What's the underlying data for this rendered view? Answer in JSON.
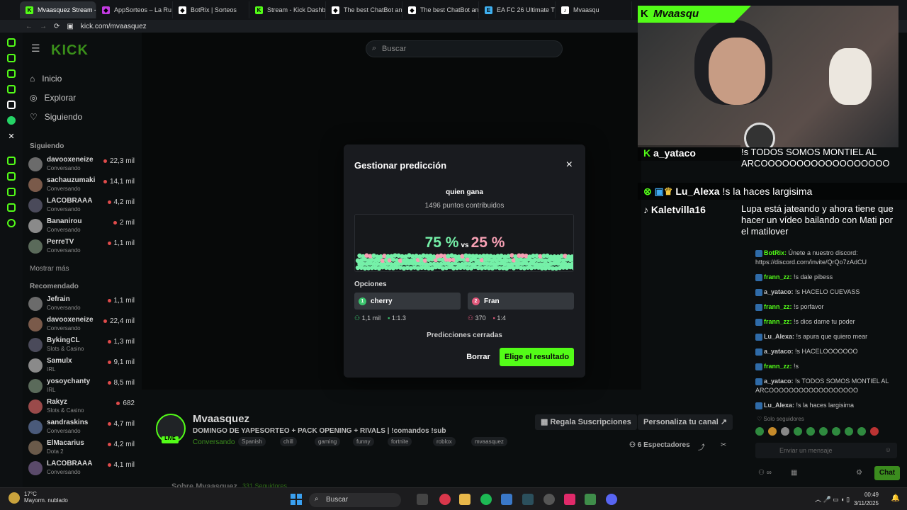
{
  "browser": {
    "tabs": [
      {
        "label": "Mvaasquez Stream - Wat",
        "color": "#53fc18",
        "glyph": "K",
        "active": true
      },
      {
        "label": "AppSorteos – La Ru",
        "color": "#c23ae0",
        "glyph": "◆",
        "active": false
      },
      {
        "label": "BotRix | Sorteos",
        "color": "#ffffff",
        "glyph": "◆",
        "active": false
      },
      {
        "label": "Stream - Kick Dashb",
        "color": "#53fc18",
        "glyph": "K",
        "active": false
      },
      {
        "label": "The best ChatBot an",
        "color": "#ffffff",
        "glyph": "◆",
        "active": false
      },
      {
        "label": "The best ChatBot an",
        "color": "#ffffff",
        "glyph": "◆",
        "active": false
      },
      {
        "label": "EA FC 26 Ultimate T",
        "color": "#3fb0f0",
        "glyph": "E",
        "active": false
      },
      {
        "label": "Mvaasqu",
        "color": "#ffffff",
        "glyph": "♪",
        "active": false
      }
    ],
    "url": "kick.com/mvaasquez"
  },
  "sidebar": {
    "nav": [
      {
        "label": "Inicio",
        "icon": "home-icon"
      },
      {
        "label": "Explorar",
        "icon": "compass-icon"
      },
      {
        "label": "Siguiendo",
        "icon": "heart-icon"
      }
    ],
    "following_title": "Siguiendo",
    "following": [
      {
        "name": "davooxeneize",
        "cat": "Conversando",
        "viewers": "22,3 mil"
      },
      {
        "name": "sachauzumaki",
        "cat": "Conversando",
        "viewers": "14,1 mil"
      },
      {
        "name": "LACOBRAAA",
        "cat": "Conversando",
        "viewers": "4,2 mil"
      },
      {
        "name": "Bananirou",
        "cat": "Conversando",
        "viewers": "2 mil"
      },
      {
        "name": "PerreTV",
        "cat": "Conversando",
        "viewers": "1,1 mil"
      }
    ],
    "show_more": "Mostrar más",
    "recommended_title": "Recomendado",
    "recommended": [
      {
        "name": "Jefrain",
        "cat": "Conversando",
        "viewers": "1,1 mil"
      },
      {
        "name": "davooxeneize",
        "cat": "Conversando",
        "viewers": "22,4 mil"
      },
      {
        "name": "BykingCL",
        "cat": "Slots & Casino",
        "viewers": "1,3 mil"
      },
      {
        "name": "Samulx",
        "cat": "IRL",
        "viewers": "9,1 mil"
      },
      {
        "name": "yosoychanty",
        "cat": "IRL",
        "viewers": "8,5 mil"
      },
      {
        "name": "Rakyz",
        "cat": "Slots & Casino",
        "viewers": "682"
      },
      {
        "name": "sandraskins",
        "cat": "Conversando",
        "viewers": "4,7 mil"
      },
      {
        "name": "ElMacarius",
        "cat": "Dota 2",
        "viewers": "4,2 mil"
      },
      {
        "name": "LACOBRAAA",
        "cat": "Conversando",
        "viewers": "4,1 mil"
      }
    ]
  },
  "search": {
    "placeholder": "Buscar"
  },
  "overlay": {
    "cam_name": "Mvaasqu",
    "line1_user": "a_yataco",
    "line1_msg": "!s TODOS SOMOS MONTIEL AL ARCOOOOOOOOOOOOOOOOOO",
    "line2_user": "Lu_Alexa",
    "line2_msg": "!s la haces largisima",
    "line3_user": "Kaletvilla16",
    "line3_msg": "Lupa está jateando y ahora tiene que hacer un vídeo bailando con Mati por el matilover"
  },
  "chat": {
    "messages": [
      {
        "user": "BotRix:",
        "text": "Únete a nuestro discord: https://discord.com/invite/QrQo7zAdCU",
        "green": true
      },
      {
        "user": "frann_zz:",
        "text": "!s dale pibess",
        "green": true
      },
      {
        "user": "a_yataco:",
        "text": "!s HACELO CUEVASS",
        "green": false
      },
      {
        "user": "frann_zz:",
        "text": "!s porfavor",
        "green": true
      },
      {
        "user": "frann_zz:",
        "text": "!s dios dame tu poder",
        "green": true
      },
      {
        "user": "Lu_Alexa:",
        "text": "!s apura que quiero mear",
        "green": false
      },
      {
        "user": "a_yataco:",
        "text": "!s HACELOOOOOOO",
        "green": false
      },
      {
        "user": "frann_zz:",
        "text": "!s",
        "green": true
      },
      {
        "user": "a_yataco:",
        "text": "!s TODOS SOMOS MONTIEL AL ARCOOOOOOOOOOOOOOOOOO",
        "green": false
      },
      {
        "user": "Lu_Alexa:",
        "text": "!s la haces largisima",
        "green": false
      }
    ],
    "followers_only": "Solo seguidores",
    "input_placeholder": "Enviar un mensaje",
    "send_label": "Chat"
  },
  "modal": {
    "title": "Gestionar predicción",
    "question": "quien gana",
    "points": "1496 puntos contribuidos",
    "pct_a": "75 %",
    "vs": "vs",
    "pct_b": "25 %",
    "options_label": "Opciones",
    "options": [
      {
        "num": "1",
        "label": "cherry",
        "color": "#3bc46d",
        "people": "1,1 mil",
        "ratio": "1:1.3"
      },
      {
        "num": "2",
        "label": "Fran",
        "color": "#e0577a",
        "people": "370",
        "ratio": "1:4"
      }
    ],
    "status": "Predicciones cerradas",
    "delete_label": "Borrar",
    "choose_label": "Elige el resultado",
    "close_icon": "×"
  },
  "stream": {
    "name": "Mvaasquez",
    "title": "DOMINGO DE YAPESORTEO + PACK OPENING + RIVALS | !comandos !sub",
    "category": "Conversando",
    "tags": [
      "Spanish",
      "chill",
      "gaming",
      "funny",
      "fortnite",
      "roblox",
      "mvaasquez"
    ],
    "live": "LIVE",
    "gift_label": "Regala Suscripciones",
    "customize_label": "Personaliza tu canal",
    "viewers": "6 Espectadores",
    "about": "Sobre Mvaasquez",
    "followers": "331 Seguidores"
  },
  "taskbar": {
    "temp": "17°C",
    "weather": "Mayorm. nublado",
    "search": "Buscar",
    "time": "00:49",
    "date": "3/11/2025"
  },
  "colors": {
    "accent": "#53fc18",
    "pink": "#f6a0b4",
    "mint": "#75f0a8"
  }
}
